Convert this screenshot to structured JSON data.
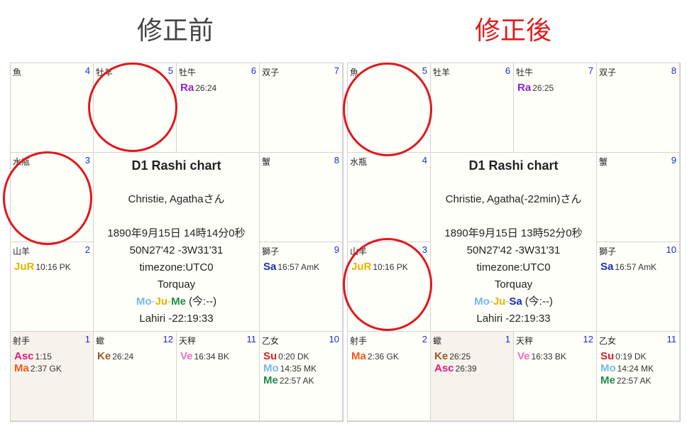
{
  "headings": {
    "before": {
      "text": "修正前",
      "color": "#444444"
    },
    "after": {
      "text": "修正後",
      "color": "#e01b1b"
    }
  },
  "colors": {
    "Ra": "#8a24c9",
    "Ju": "#e3b400",
    "Sa": "#1a2cb8",
    "Asc": "#e5197d",
    "Ma": "#f05a1a",
    "Ke": "#9a5a2a",
    "Ve": "#f06fbf",
    "Su": "#d62020",
    "Mo": "#74b9e8",
    "Me": "#1f8c4a",
    "highlight": "#e0171d"
  },
  "charts": {
    "before": {
      "title": "D1 Rashi chart",
      "name": "Christie, Agathaさん",
      "datetime": "1890年9月15日 14時14分0秒",
      "coords": "50N27'42 -3W31'31",
      "timezone": "timezone:UTC0",
      "place": "Torquay",
      "aspect": [
        {
          "abbr": "Mo",
          "sep": "-"
        },
        {
          "abbr": "Ju",
          "sep": "-"
        },
        {
          "abbr": "Me",
          "sep": ""
        }
      ],
      "aspect_suffix": "(今:--)",
      "ayanamsa": "Lahiri -22:19:33",
      "cells": [
        {
          "sign": "魚",
          "num": "4",
          "planets": []
        },
        {
          "sign": "牡羊",
          "num": "5",
          "planets": []
        },
        {
          "sign": "牡牛",
          "num": "6",
          "planets": [
            {
              "abbr": "Ra",
              "info": "26:24"
            }
          ]
        },
        {
          "sign": "双子",
          "num": "7",
          "planets": []
        },
        {
          "sign": "蟹",
          "num": "8",
          "planets": []
        },
        {
          "sign": "獅子",
          "num": "9",
          "planets": [
            {
              "abbr": "Sa",
              "info": "16:57 AmK"
            }
          ]
        },
        {
          "sign": "乙女",
          "num": "10",
          "planets": [
            {
              "abbr": "Su",
              "info": "0:20 DK"
            },
            {
              "abbr": "Mo",
              "info": "14:35 MK"
            },
            {
              "abbr": "Me",
              "info": "22:57 AK"
            }
          ]
        },
        {
          "sign": "天秤",
          "num": "11",
          "planets": [
            {
              "abbr": "Ve",
              "info": "16:34 BK"
            }
          ]
        },
        {
          "sign": "蠍",
          "num": "12",
          "planets": [
            {
              "abbr": "Ke",
              "info": "26:24"
            }
          ]
        },
        {
          "sign": "射手",
          "num": "1",
          "shaded": true,
          "planets": [
            {
              "abbr": "Asc",
              "info": "1:15"
            },
            {
              "abbr": "Ma",
              "info": "2:37 GK"
            }
          ]
        },
        {
          "sign": "山羊",
          "num": "2",
          "planets": [
            {
              "abbr": "JuR",
              "info": "10:16 PK",
              "color_key": "Ju"
            }
          ]
        },
        {
          "sign": "水瓶",
          "num": "3",
          "planets": []
        }
      ]
    },
    "after": {
      "title": "D1 Rashi chart",
      "name": "Christie, Agatha(-22min)さん",
      "datetime": "1890年9月15日 13時52分0秒",
      "coords": "50N27'42 -3W31'31",
      "timezone": "timezone:UTC0",
      "place": "Torquay",
      "aspect": [
        {
          "abbr": "Mo",
          "sep": "-"
        },
        {
          "abbr": "Ju",
          "sep": "-"
        },
        {
          "abbr": "Sa",
          "sep": ""
        }
      ],
      "aspect_suffix": "(今:--)",
      "ayanamsa": "Lahiri -22:19:33",
      "cells": [
        {
          "sign": "魚",
          "num": "5",
          "planets": []
        },
        {
          "sign": "牡羊",
          "num": "6",
          "planets": []
        },
        {
          "sign": "牡牛",
          "num": "7",
          "planets": [
            {
              "abbr": "Ra",
              "info": "26:25"
            }
          ]
        },
        {
          "sign": "双子",
          "num": "8",
          "planets": []
        },
        {
          "sign": "蟹",
          "num": "9",
          "planets": []
        },
        {
          "sign": "獅子",
          "num": "10",
          "planets": [
            {
              "abbr": "Sa",
              "info": "16:57 AmK"
            }
          ]
        },
        {
          "sign": "乙女",
          "num": "11",
          "planets": [
            {
              "abbr": "Su",
              "info": "0:19 DK"
            },
            {
              "abbr": "Mo",
              "info": "14:24 MK"
            },
            {
              "abbr": "Me",
              "info": "22:57 AK"
            }
          ]
        },
        {
          "sign": "天秤",
          "num": "12",
          "planets": [
            {
              "abbr": "Ve",
              "info": "16:33 BK"
            }
          ]
        },
        {
          "sign": "蠍",
          "num": "1",
          "shaded": true,
          "planets": [
            {
              "abbr": "Ke",
              "info": "26:25"
            },
            {
              "abbr": "Asc",
              "info": "26:39"
            }
          ]
        },
        {
          "sign": "射手",
          "num": "2",
          "planets": [
            {
              "abbr": "Ma",
              "info": "2:36 GK"
            }
          ]
        },
        {
          "sign": "山羊",
          "num": "3",
          "planets": [
            {
              "abbr": "JuR",
              "info": "10:16 PK",
              "color_key": "Ju"
            }
          ]
        },
        {
          "sign": "水瓶",
          "num": "4",
          "planets": []
        }
      ]
    }
  }
}
